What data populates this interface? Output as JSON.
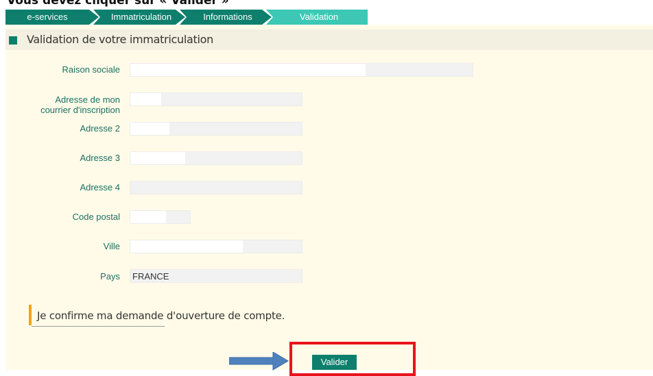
{
  "heading": "Vous devez cliquer sur « Valider »",
  "breadcrumb": {
    "steps": [
      "e-services",
      "Immatriculation",
      "Informations",
      "Validation"
    ]
  },
  "section": {
    "title": "Validation de votre immatriculation"
  },
  "form": {
    "raison_sociale_label": "Raison sociale",
    "adresse1_label": "Adresse de mon courrier d'inscription",
    "adresse1_line1": "Adresse de mon",
    "adresse1_line2": "courrier d'inscription",
    "adresse2_label": "Adresse 2",
    "adresse3_label": "Adresse 3",
    "adresse4_label": "Adresse 4",
    "code_postal_label": "Code postal",
    "ville_label": "Ville",
    "pays_label": "Pays",
    "pays_value": "FRANCE"
  },
  "confirm_text": "Je confirme ma demande d'ouverture de compte.",
  "submit_label": "Valider",
  "colors": {
    "brand_green": "#0e7f6c",
    "active_step": "#3cc8b4",
    "accent_orange": "#f0a31c",
    "highlight_red": "#e8141b",
    "arrow_blue": "#4f81bd"
  }
}
